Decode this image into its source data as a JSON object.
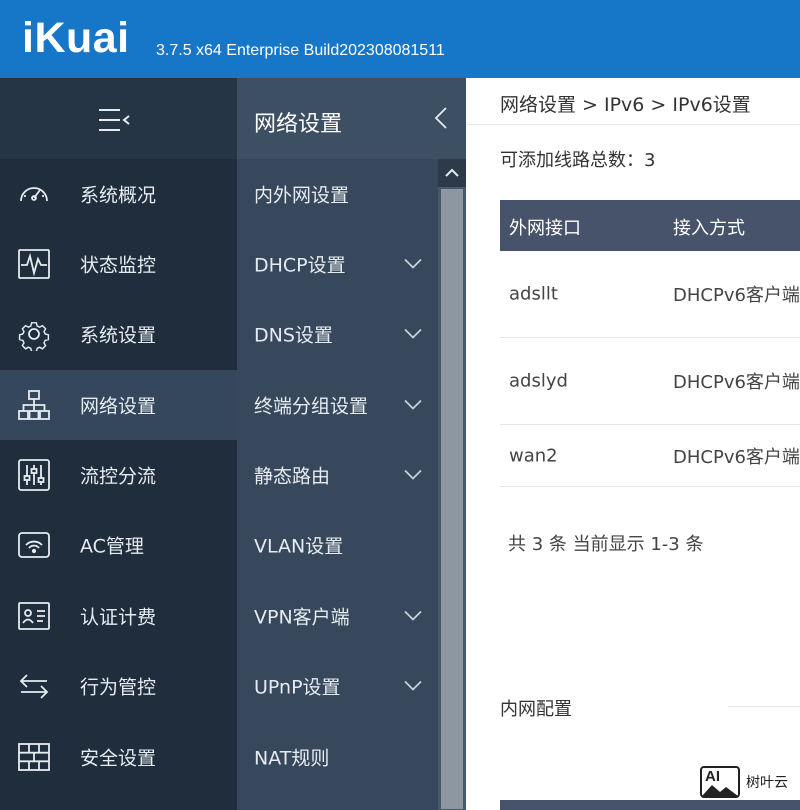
{
  "header": {
    "logo": "iKuai",
    "version": "3.7.5 x64 Enterprise Build202308081511"
  },
  "primary_nav": {
    "items": [
      {
        "label": "系统概况",
        "icon": "dashboard-icon"
      },
      {
        "label": "状态监控",
        "icon": "monitor-pulse-icon"
      },
      {
        "label": "系统设置",
        "icon": "gear-icon"
      },
      {
        "label": "网络设置",
        "icon": "network-topology-icon",
        "active": true
      },
      {
        "label": "流控分流",
        "icon": "sliders-icon"
      },
      {
        "label": "AC管理",
        "icon": "wifi-router-icon"
      },
      {
        "label": "认证计费",
        "icon": "id-card-icon"
      },
      {
        "label": "行为管控",
        "icon": "swap-arrows-icon"
      },
      {
        "label": "安全设置",
        "icon": "firewall-icon"
      }
    ]
  },
  "sub_nav": {
    "title": "网络设置",
    "items": [
      {
        "label": "内外网设置",
        "expandable": false
      },
      {
        "label": "DHCP设置",
        "expandable": true
      },
      {
        "label": "DNS设置",
        "expandable": true
      },
      {
        "label": "终端分组设置",
        "expandable": true
      },
      {
        "label": "静态路由",
        "expandable": true
      },
      {
        "label": "VLAN设置",
        "expandable": false
      },
      {
        "label": "VPN客户端",
        "expandable": true
      },
      {
        "label": "UPnP设置",
        "expandable": true
      },
      {
        "label": "NAT规则",
        "expandable": false
      }
    ]
  },
  "main": {
    "breadcrumb": "网络设置 > IPv6 > IPv6设置",
    "line_total": "可添加线路总数：3",
    "table": {
      "headers": [
        "外网接口",
        "接入方式"
      ],
      "rows": [
        [
          "adsllt",
          "DHCPv6客户端"
        ],
        [
          "adslyd",
          "DHCPv6客户端"
        ],
        [
          "wan2",
          "DHCPv6客户端"
        ]
      ]
    },
    "pagination": "共 3 条 当前显示 1-3 条",
    "lan_section_label": "内网配置"
  },
  "watermark": {
    "logo_text": "AI",
    "text": "树叶云"
  },
  "colors": {
    "header_bg": "#1677c9",
    "primary_nav_bg": "#1f2d3d",
    "primary_nav_active": "#34475d",
    "sub_nav_bg": "#37485c",
    "table_header_bg": "#47536a"
  }
}
